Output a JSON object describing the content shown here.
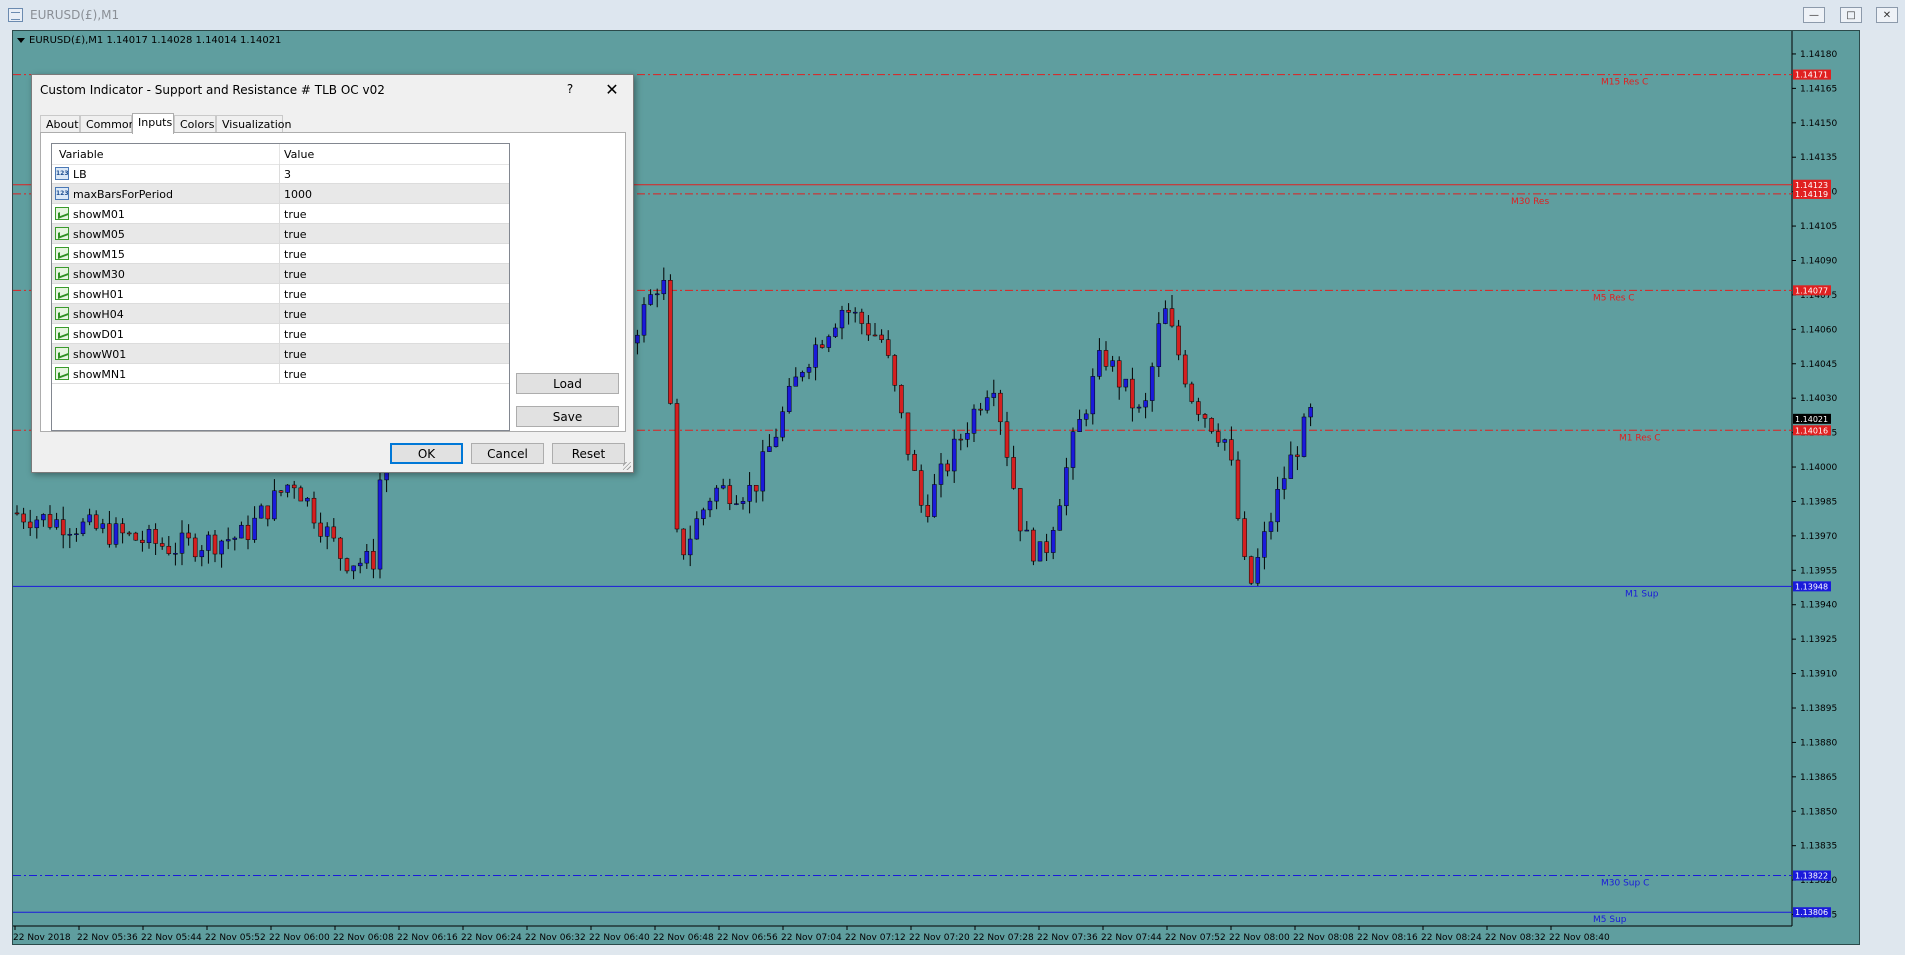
{
  "window": {
    "title": "EURUSD(£),M1"
  },
  "chart": {
    "symbol_info": "EURUSD(£),M1  1.14017 1.14028 1.14014 1.14021",
    "price_labels": [
      "1.14180",
      "1.14165",
      "1.14150",
      "1.14135",
      "1.14120",
      "1.14105",
      "1.14090",
      "1.14075",
      "1.14060",
      "1.14045",
      "1.14030",
      "1.14015",
      "1.14000",
      "1.13985",
      "1.13970",
      "1.13955",
      "1.13940",
      "1.13925",
      "1.13910",
      "1.13895",
      "1.13880",
      "1.13865",
      "1.13850",
      "1.13835",
      "1.13820",
      "1.13805"
    ],
    "time_labels": [
      "22 Nov 2018",
      "22 Nov 05:36",
      "22 Nov 05:44",
      "22 Nov 05:52",
      "22 Nov 06:00",
      "22 Nov 06:08",
      "22 Nov 06:16",
      "22 Nov 06:24",
      "22 Nov 06:32",
      "22 Nov 06:40",
      "22 Nov 06:48",
      "22 Nov 06:56",
      "22 Nov 07:04",
      "22 Nov 07:12",
      "22 Nov 07:20",
      "22 Nov 07:28",
      "22 Nov 07:36",
      "22 Nov 07:44",
      "22 Nov 07:52",
      "22 Nov 08:00",
      "22 Nov 08:08",
      "22 Nov 08:16",
      "22 Nov 08:24",
      "22 Nov 08:32",
      "22 Nov 08:40"
    ],
    "levels": [
      {
        "name": "M15 Res C",
        "price": 1.14171,
        "tag": "1.14171",
        "color": "#e02020",
        "style": "dashdot"
      },
      {
        "name": "",
        "price": 1.14123,
        "tag": "1.14123",
        "color": "#e02020",
        "style": "solid"
      },
      {
        "name": "M30 Res",
        "price": 1.14119,
        "tag": "1.14119",
        "color": "#e02020",
        "style": "dashdot"
      },
      {
        "name": "M5 Res C",
        "price": 1.14077,
        "tag": "1.14077",
        "color": "#e02020",
        "style": "dashdot"
      },
      {
        "name": "M1 Res C",
        "price": 1.14016,
        "tag": "1.14016",
        "color": "#e02020",
        "style": "dashdot"
      },
      {
        "name": "M1 Sup",
        "price": 1.13948,
        "tag": "1.13948",
        "color": "#1a1adb",
        "style": "solid"
      },
      {
        "name": "M30 Sup C",
        "price": 1.13822,
        "tag": "1.13822",
        "color": "#1a1adb",
        "style": "dashdot"
      },
      {
        "name": "M5 Sup",
        "price": 1.13806,
        "tag": "1.13806",
        "color": "#1a1adb",
        "style": "solid"
      }
    ],
    "current_price": "1.14021",
    "colors": {
      "background": "#5f9e9f",
      "bull": "#1a1adb",
      "bear": "#d42020",
      "grid": "#3d6f70",
      "text": "#000000"
    }
  },
  "dialog": {
    "title": "Custom Indicator - Support and Resistance # TLB OC v02",
    "help": "?",
    "close": "✕",
    "tabs": [
      "About",
      "Common",
      "Inputs",
      "Colors",
      "Visualization"
    ],
    "active_tab": "Inputs",
    "columns": [
      "Variable",
      "Value"
    ],
    "params": [
      {
        "icon": "123",
        "type": "num",
        "name": "LB",
        "value": "3"
      },
      {
        "icon": "123",
        "type": "num",
        "name": "maxBarsForPeriod",
        "value": "1000"
      },
      {
        "icon": "",
        "type": "bool",
        "name": "showM01",
        "value": "true"
      },
      {
        "icon": "",
        "type": "bool",
        "name": "showM05",
        "value": "true"
      },
      {
        "icon": "",
        "type": "bool",
        "name": "showM15",
        "value": "true"
      },
      {
        "icon": "",
        "type": "bool",
        "name": "showM30",
        "value": "true"
      },
      {
        "icon": "",
        "type": "bool",
        "name": "showH01",
        "value": "true"
      },
      {
        "icon": "",
        "type": "bool",
        "name": "showH04",
        "value": "true"
      },
      {
        "icon": "",
        "type": "bool",
        "name": "showD01",
        "value": "true"
      },
      {
        "icon": "",
        "type": "bool",
        "name": "showW01",
        "value": "true"
      },
      {
        "icon": "",
        "type": "bool",
        "name": "showMN1",
        "value": "true"
      }
    ],
    "buttons": {
      "load": "Load",
      "save": "Save",
      "ok": "OK",
      "cancel": "Cancel",
      "reset": "Reset"
    }
  }
}
